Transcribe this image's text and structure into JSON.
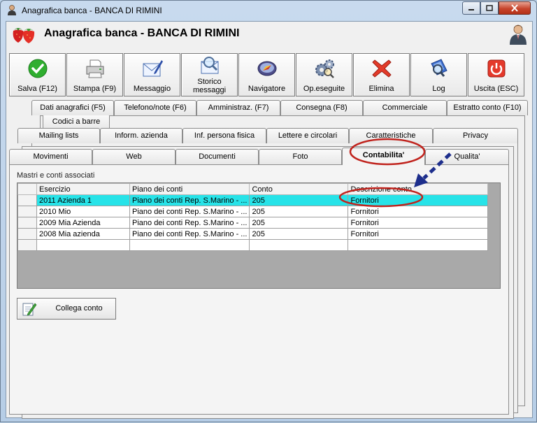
{
  "window": {
    "title": "Anagrafica banca - BANCA DI RIMINI"
  },
  "header": {
    "title": "Anagrafica banca - BANCA DI RIMINI"
  },
  "toolbar": [
    {
      "label": "Salva (F12)",
      "icon": "check-icon"
    },
    {
      "label": "Stampa (F9)",
      "icon": "printer-icon"
    },
    {
      "label": "Messaggio",
      "icon": "envelope-pen-icon"
    },
    {
      "label": "Storico messaggi",
      "icon": "envelope-search-icon"
    },
    {
      "label": "Navigatore",
      "icon": "compass-icon"
    },
    {
      "label": "Op.eseguite",
      "icon": "gears-icon"
    },
    {
      "label": "Elimina",
      "icon": "delete-x-icon"
    },
    {
      "label": "Log",
      "icon": "log-search-icon"
    },
    {
      "label": "Uscita (ESC)",
      "icon": "power-icon"
    }
  ],
  "tabs": {
    "row1": [
      "Codici a barre"
    ],
    "row2": [
      "Dati anagrafici (F5)",
      "Telefono/note (F6)",
      "Amministraz. (F7)",
      "Consegna (F8)",
      "Commerciale",
      "Estratto conto (F10)"
    ],
    "row3": [
      "Mailing lists",
      "Inform. azienda",
      "Inf. persona fisica",
      "Lettere e circolari",
      "Caratteristiche",
      "Privacy"
    ],
    "row4": [
      "Movimenti",
      "Web",
      "Documenti",
      "Foto",
      "Contabilita'",
      "Qualita'"
    ],
    "active": "Contabilita'"
  },
  "panel": {
    "section_label": "Mastri e conti associati",
    "columns": [
      "Esercizio",
      "Piano dei conti",
      "Conto",
      "Descrizione conto"
    ],
    "rows": [
      [
        "2011 Azienda 1",
        "Piano dei conti Rep. S.Marino - ...",
        "205",
        "Fornitori"
      ],
      [
        "2010 Mio",
        "Piano dei conti Rep. S.Marino - ...",
        "205",
        "Fornitori"
      ],
      [
        "2009 Mia Azienda",
        "Piano dei conti Rep. S.Marino - ...",
        "205",
        "Fornitori"
      ],
      [
        "2008 Mia azienda",
        "Piano dei conti Rep. S.Marino - ...",
        "205",
        "Fornitori"
      ]
    ],
    "selected_row": 0,
    "link_button": "Collega conto"
  },
  "colors": {
    "selection": "#27e3e8",
    "annotation": "#c0231d",
    "arrow": "#1d2e8c"
  }
}
